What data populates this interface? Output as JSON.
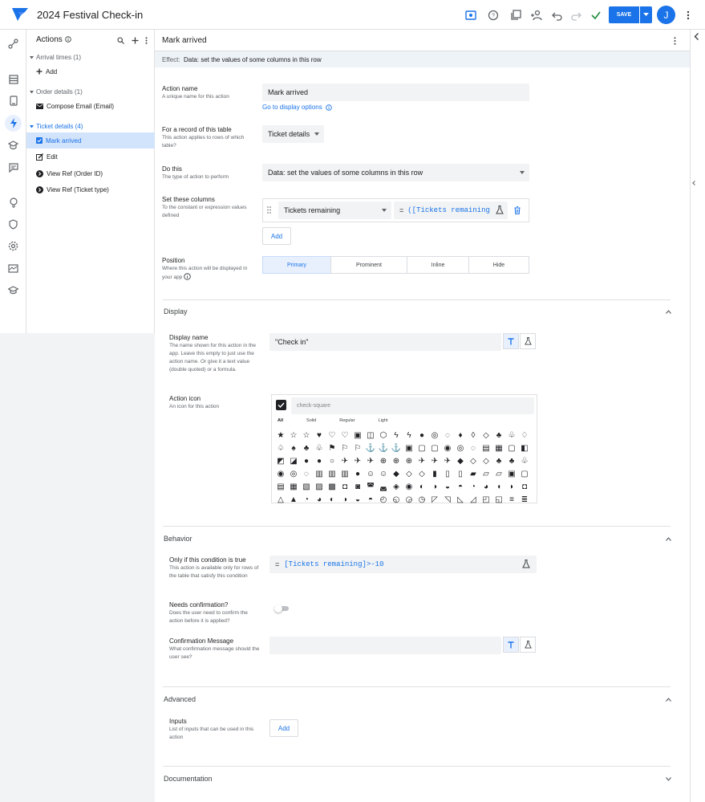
{
  "app": {
    "title": "2024 Festival Check-in",
    "save_label": "SAVE",
    "avatar_initial": "J",
    "accent": "#1a73e8"
  },
  "tree": {
    "title": "Actions",
    "groups": [
      {
        "label": "Arrival times (1)",
        "items": [
          "Add"
        ]
      },
      {
        "label": "Order details (1)",
        "items": [
          "Compose Email (Email)"
        ]
      },
      {
        "label": "Ticket details (4)",
        "items": [
          "Mark arrived",
          "Edit",
          "View Ref (Order ID)",
          "View Ref (Ticket type)"
        ]
      }
    ]
  },
  "main": {
    "header_title": "Mark arrived",
    "effect_label": "Effect:",
    "effect_value": "Data: set the values of some columns in this row",
    "action_name": {
      "label": "Action name",
      "help": "A unique name for this action",
      "value": "Mark arrived",
      "link": "Go to display options"
    },
    "record_table": {
      "label": "For a record of this table",
      "help": "This action applies to rows of which table?",
      "value": "Ticket details"
    },
    "do_this": {
      "label": "Do this",
      "help": "The type of action to perform",
      "value": "Data: set the values of some columns in this row"
    },
    "set_columns": {
      "label": "Set these columns",
      "help": "To the constant or expression values defined",
      "column": "Tickets remaining",
      "eq": "=",
      "expression": "([Tickets remaining",
      "add_label": "Add"
    },
    "position": {
      "label": "Position",
      "help": "Where this action will be displayed in your app",
      "options": [
        "Primary",
        "Prominent",
        "Inline",
        "Hide"
      ],
      "selected": "Primary"
    }
  },
  "display": {
    "title": "Display",
    "display_name": {
      "label": "Display name",
      "help": "The name shown for this action in the app. Leave this empty to just use the action name. Or give it a text value (double quoted) or a formula.",
      "value": "\"Check in\""
    },
    "action_icon": {
      "label": "Action icon",
      "help": "An icon for this action",
      "placeholder": "check-square",
      "tabs": [
        "All",
        "Solid",
        "Regular",
        "Light"
      ]
    }
  },
  "behavior": {
    "title": "Behavior",
    "only_if": {
      "label": "Only if this condition is true",
      "help": "This action is available only for rows of the table that satisfy this condition",
      "eq": "=",
      "expression": "[Tickets remaining]>-10"
    },
    "needs_confirmation": {
      "label": "Needs confirmation?",
      "help": "Does the user need to confirm the action before it is applied?",
      "on": false
    },
    "confirmation_message": {
      "label": "Confirmation Message",
      "help": "What confirmation message should the user see?",
      "value": ""
    }
  },
  "advanced": {
    "title": "Advanced",
    "inputs": {
      "label": "Inputs",
      "help": "List of inputs that can be used in this action",
      "add_label": "Add"
    }
  },
  "documentation": {
    "title": "Documentation"
  }
}
